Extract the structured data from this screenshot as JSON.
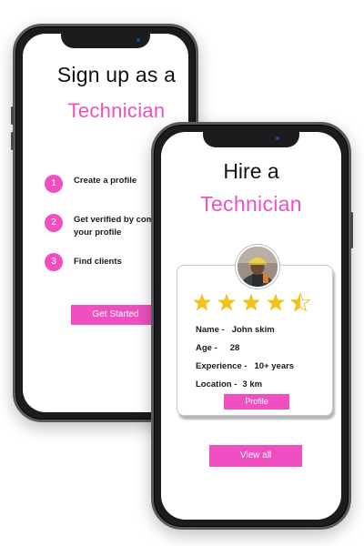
{
  "colors": {
    "accent": "#f04fc1",
    "phone_frame": "#1c1c1e",
    "star": "#f2c21a"
  },
  "signup_screen": {
    "title": "Sign up as a",
    "subtitle": "Technician",
    "steps": [
      {
        "number": "1",
        "text": "Create a profile"
      },
      {
        "number": "2",
        "text": "Get verified by comp\nyour profile"
      },
      {
        "number": "3",
        "text": "Find clients"
      }
    ],
    "cta_label": "Get Started"
  },
  "hire_screen": {
    "title": "Hire a",
    "subtitle": "Technician",
    "technician": {
      "rating": 4.5,
      "rating_max": 5,
      "name_label": "Name -",
      "name": "John skim",
      "age_label": "Age -",
      "age": "28",
      "experience_label": "Experience -",
      "experience": "10+ years",
      "location_label": "Location -",
      "location": "3 km"
    },
    "profile_label": "Profile",
    "view_all_label": "View all"
  },
  "icons": {
    "avatar": "technician-avatar",
    "star": "star-icon"
  }
}
